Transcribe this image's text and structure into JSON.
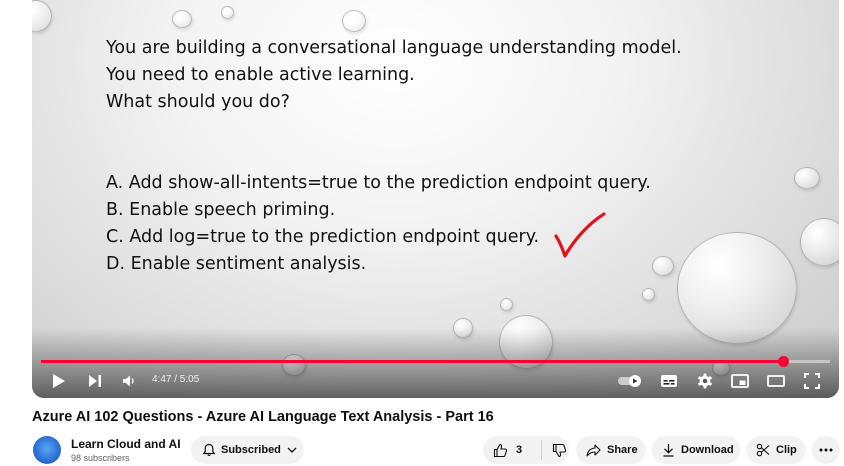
{
  "slide": {
    "question_lines": [
      "You are building a conversational language understanding model.",
      "You need to enable active learning.",
      "What should you do?"
    ],
    "options": [
      "A. Add show-all-intents=true to the prediction endpoint query.",
      "B. Enable speech priming.",
      "C. Add log=true to the prediction endpoint query.",
      "D. Enable sentiment analysis."
    ],
    "checkmark_color": "#e0141e"
  },
  "player": {
    "time_display": "4:47 / 5:05",
    "progress_fraction": 0.94,
    "progress_color": "#ff0033",
    "icons": [
      "play-icon",
      "next-icon",
      "volume-icon",
      "autoplay-toggle",
      "subtitles-icon",
      "settings-icon",
      "miniplayer-icon",
      "theater-icon",
      "fullscreen-icon"
    ]
  },
  "video": {
    "title": "Azure AI 102 Questions - Azure AI Language Text Analysis - Part 16"
  },
  "channel": {
    "name": "Learn Cloud and AI",
    "subscribers": "98 subscribers",
    "subscribed_label": "Subscribed"
  },
  "actions": {
    "like_count": "3",
    "share_label": "Share",
    "download_label": "Download",
    "clip_label": "Clip"
  }
}
